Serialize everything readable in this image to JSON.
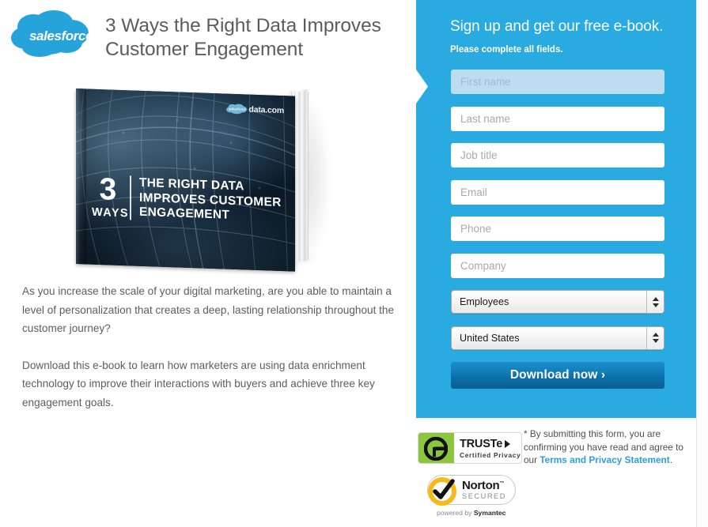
{
  "brand": {
    "logo_name": "salesforce-cloud-logo",
    "logo_text": "salesforce",
    "logo_color": "#00A1E0",
    "panel_color": "#29abe2",
    "link_color": "#2b9fd9",
    "button_color": "#0c6fa8"
  },
  "header": {
    "headline_line1": "3 Ways the Right Data Improves",
    "headline_line2": "Customer Engagement"
  },
  "book": {
    "alt": "e-book cover",
    "number": "3",
    "ways": "WAYS",
    "title_line1": "THE RIGHT DATA",
    "title_line2": "IMPROVES CUSTOMER",
    "title_line3": "ENGAGEMENT",
    "corner_logo_text": "data.com"
  },
  "body": {
    "paragraph1": "As you increase the scale of your digital marketing, are you able to maintain a level of personalization that creates a deep, lasting relationship throughout the customer journey?",
    "paragraph2": "Download this e-book to learn how marketers are using data enrichment technology to improve their interactions with buyers and achieve three key engagement goals."
  },
  "form": {
    "title": "Sign up and get our free e-book.",
    "subtitle": "Please complete all fields.",
    "fields": [
      {
        "name": "first-name",
        "placeholder": "First name",
        "value": "",
        "focused": true
      },
      {
        "name": "last-name",
        "placeholder": "Last name",
        "value": "",
        "focused": false
      },
      {
        "name": "job-title",
        "placeholder": "Job title",
        "value": "",
        "focused": false
      },
      {
        "name": "email",
        "placeholder": "Email",
        "value": "",
        "focused": false
      },
      {
        "name": "phone",
        "placeholder": "Phone",
        "value": "",
        "focused": false
      },
      {
        "name": "company",
        "placeholder": "Company",
        "value": "",
        "focused": false
      }
    ],
    "selects": [
      {
        "name": "employees",
        "selected": "Employees"
      },
      {
        "name": "country",
        "selected": "United States"
      }
    ],
    "submit_label": "Download now ›"
  },
  "trust": {
    "truste": {
      "name": "truste-certified-privacy-badge",
      "title": "TRUSTe",
      "subtitle": "Certified Privacy"
    },
    "norton": {
      "name": "norton-secured-badge",
      "title": "Norton",
      "subtitle": "SECURED",
      "powered_prefix": "powered by ",
      "powered_brand": "Symantec"
    },
    "legal_text": "* By submitting this form, you are confirming you have read and agree to our ",
    "legal_link": "Terms and Privacy Statement",
    "legal_suffix": "."
  }
}
